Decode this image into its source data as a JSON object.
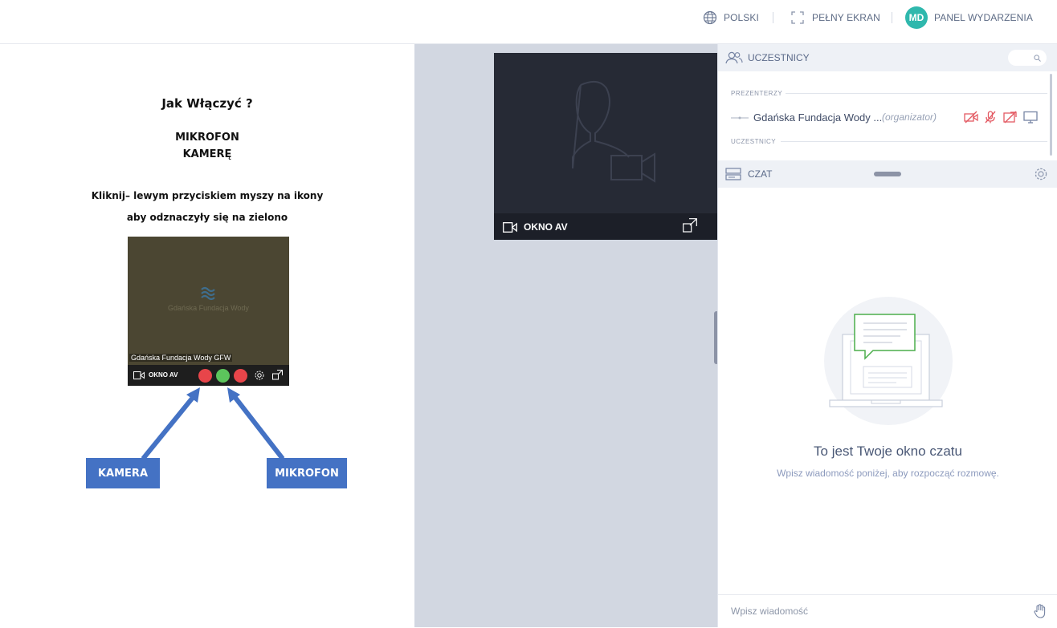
{
  "topbar": {
    "language": "POLSKI",
    "fullscreen": "PEŁNY EKRAN",
    "avatar_initials": "MD",
    "event_panel": "PANEL WYDARZENIA"
  },
  "slide": {
    "heading": "Jak Włączyć ?",
    "item1": "MIKROFON",
    "item2": "KAMERĘ",
    "instruction1": "Kliknij– lewym przyciskiem myszy na ikony",
    "instruction2": "aby odznaczyły się na zielono",
    "video_logo_text": "Gdańska Fundacja Wody",
    "video_name": "Gdańska Fundacja Wody GFW",
    "video_label": "OKNO AV",
    "label_camera": "KAMERA",
    "label_mic": "MIKROFON"
  },
  "av_window": {
    "label": "OKNO AV"
  },
  "participants": {
    "title": "UCZESTNICY",
    "presenters_label": "PREZENTERZY",
    "presenter_name": "Gdańska Fundacja Wody ...",
    "presenter_role": "(organizator)",
    "participants_label": "UCZESTNICY"
  },
  "chat": {
    "title": "CZAT",
    "empty_title": "To jest Twoje okno czatu",
    "empty_subtitle": "Wpisz wiadomość poniżej, aby rozpocząć rozmowę.",
    "input_placeholder": "Wpisz wiadomość"
  },
  "colors": {
    "accent": "#2fb8ad",
    "stage_bg": "#d2d7e1",
    "av_bg": "#262a35",
    "arrow_blue": "#4472c4",
    "chat_illustration_green": "#4cae4c"
  },
  "icons": [
    "globe-icon",
    "fullscreen-icon",
    "users-icon",
    "search-icon",
    "camera-off-icon",
    "mic-off-icon",
    "share-off-icon",
    "screen-icon",
    "chat-icon",
    "gear-icon",
    "video-camera-icon",
    "expand-icon",
    "raise-hand-icon"
  ]
}
